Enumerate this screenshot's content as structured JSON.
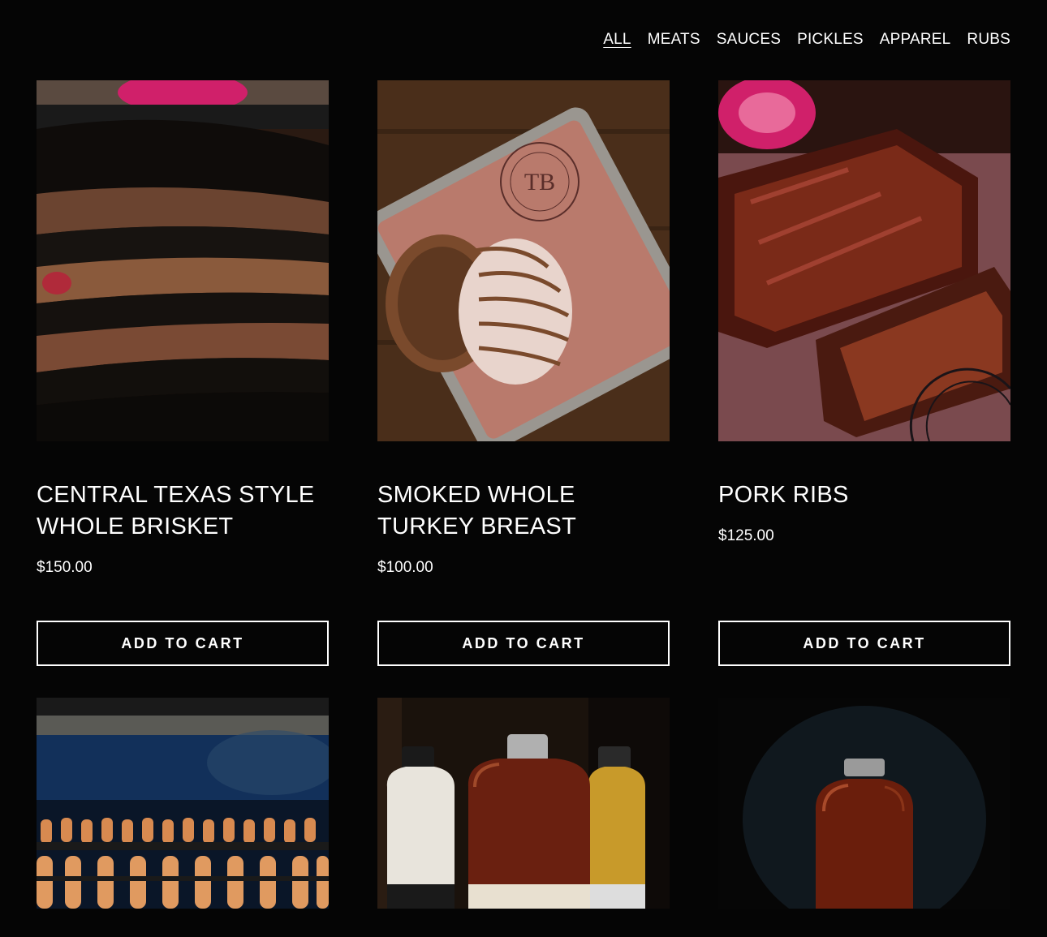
{
  "filter_nav": {
    "items": [
      {
        "label": "ALL",
        "active": true
      },
      {
        "label": "MEATS",
        "active": false
      },
      {
        "label": "SAUCES",
        "active": false
      },
      {
        "label": "PICKLES",
        "active": false
      },
      {
        "label": "APPAREL",
        "active": false
      },
      {
        "label": "RUBS",
        "active": false
      }
    ]
  },
  "products": [
    {
      "title": "CENTRAL TEXAS STYLE\nWHOLE BRISKET",
      "price": "$150.00",
      "button": "ADD TO CART",
      "image": "brisket-photo"
    },
    {
      "title": "SMOKED WHOLE\nTURKEY BREAST",
      "price": "$100.00",
      "button": "ADD TO CART",
      "image": "turkey-breast-photo"
    },
    {
      "title": "PORK RIBS",
      "price": "$125.00",
      "button": "ADD TO CART",
      "image": "pork-ribs-photo"
    },
    {
      "image": "sausages-smoker-photo"
    },
    {
      "image": "sauce-bottles-photo"
    },
    {
      "image": "hot-sauce-bottle-photo"
    }
  ],
  "colors": {
    "background": "#050505",
    "text": "#ffffff",
    "button_border": "#ffffff"
  }
}
